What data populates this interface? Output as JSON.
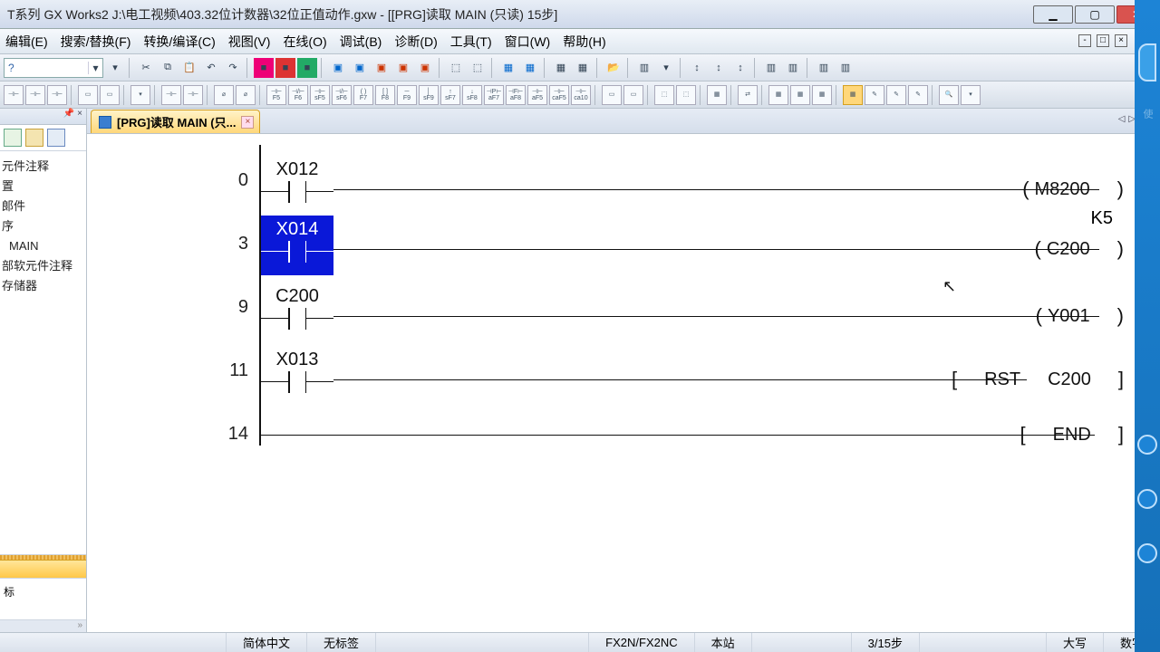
{
  "window": {
    "title": "T系列 GX Works2 J:\\电工视频\\403.32位计数器\\32位正值动作.gxw - [[PRG]读取 MAIN (只读) 15步]"
  },
  "menu": {
    "edit": "编辑(E)",
    "search": "搜索/替换(F)",
    "convert": "转换/编译(C)",
    "view": "视图(V)",
    "online": "在线(O)",
    "debug": "调试(B)",
    "diagnose": "诊断(D)",
    "tools": "工具(T)",
    "window": "窗口(W)",
    "help": "帮助(H)"
  },
  "tab": {
    "label": "[PRG]读取 MAIN (只..."
  },
  "tree": {
    "i0": "元件注释",
    "i1": "置",
    "i2": "郞件",
    "i3": "序",
    "i4": "MAIN",
    "i5": "部软元件注释",
    "i6": "存储器",
    "target": "标"
  },
  "ladder": {
    "r0": {
      "step": "0",
      "contact": "X012",
      "coil": "M8200"
    },
    "r1": {
      "step": "3",
      "contact": "X014",
      "k": "K5",
      "coil": "C200"
    },
    "r2": {
      "step": "9",
      "contact": "C200",
      "coil": "Y001"
    },
    "r3": {
      "step": "11",
      "contact": "X013",
      "inst": "RST",
      "op": "C200"
    },
    "r4": {
      "step": "14",
      "inst": "END"
    }
  },
  "status": {
    "lang": "简体中文",
    "label": "无标签",
    "plc": "FX2N/FX2NC",
    "station": "本站",
    "steps": "3/15步",
    "caps": "大写",
    "num": "数字"
  }
}
